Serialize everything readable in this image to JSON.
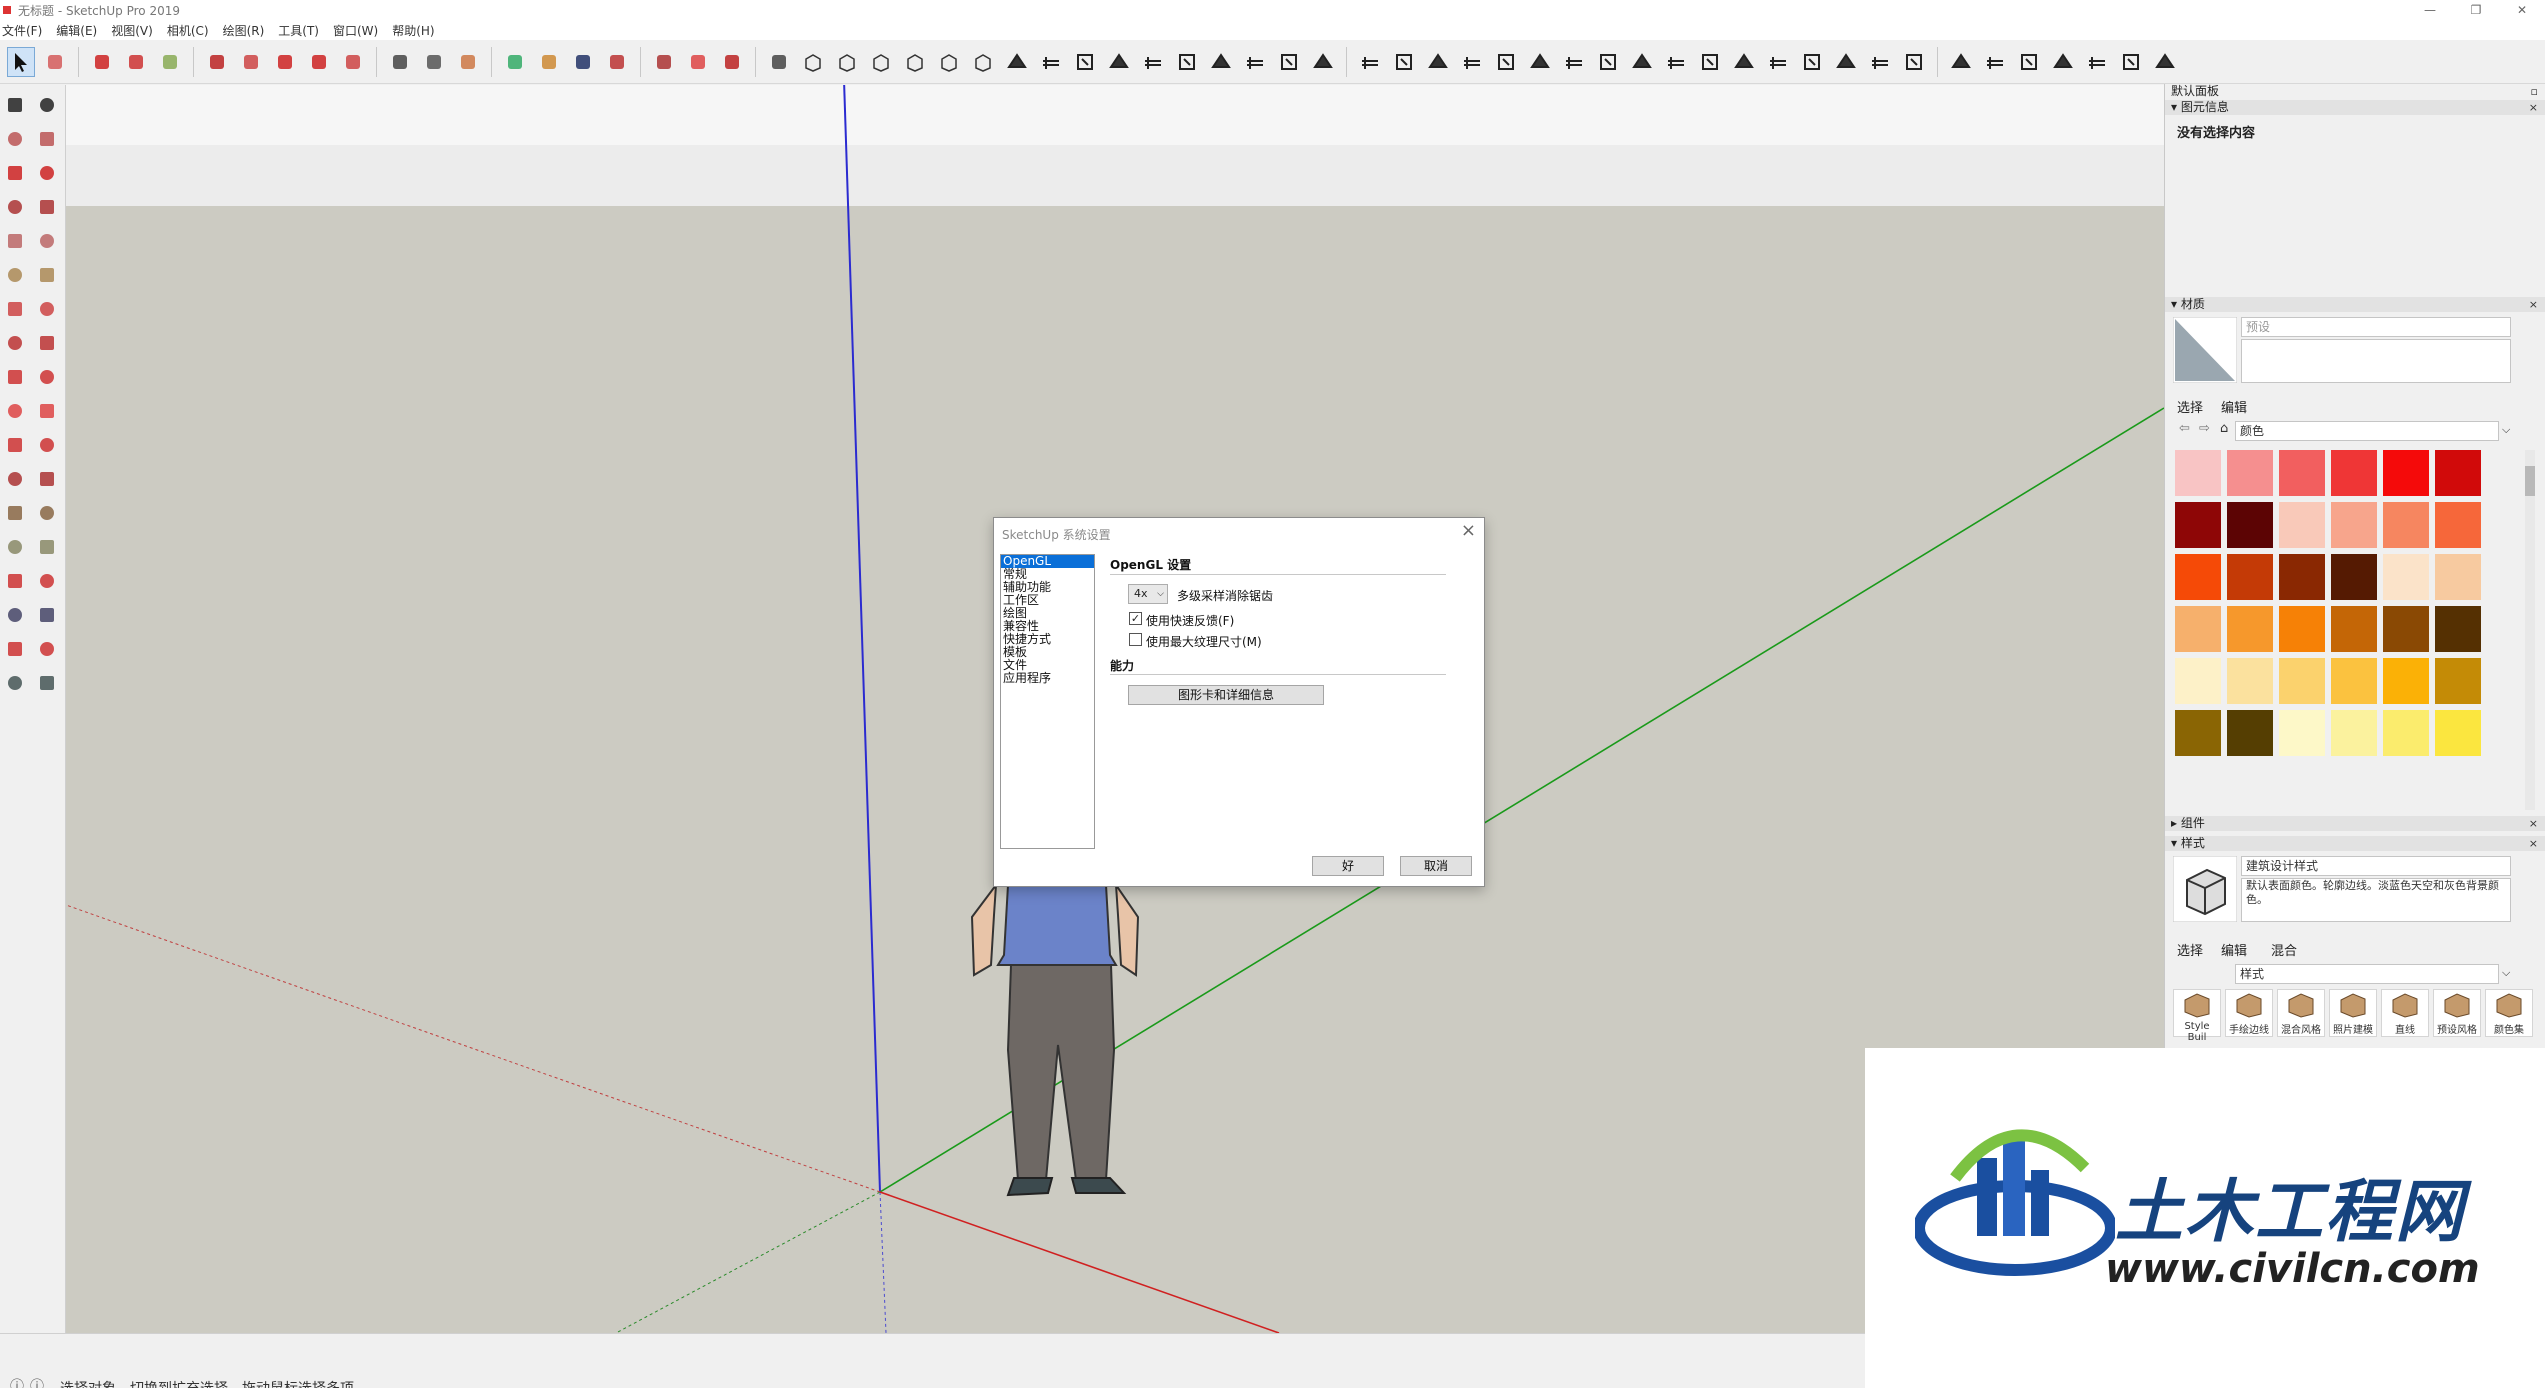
{
  "window": {
    "title": "无标题 - SketchUp Pro 2019",
    "controls": [
      "—",
      "❐",
      "✕"
    ]
  },
  "menus": [
    "文件(F)",
    "编辑(E)",
    "视图(V)",
    "相机(C)",
    "绘图(R)",
    "工具(T)",
    "窗口(W)",
    "帮助(H)"
  ],
  "toolbar": {
    "tools": [
      "select-icon",
      "eraser-icon",
      "line-icon",
      "arc-icon",
      "rectangle-icon",
      "pushpull-icon",
      "followme-icon",
      "move-icon",
      "rotate-icon",
      "scale-icon",
      "tape-icon",
      "text-icon",
      "paint-icon",
      "orbit-icon",
      "pan-icon",
      "zoom-icon",
      "zoomextents-icon",
      "warehouse-icon",
      "extension-icon",
      "ruby-icon",
      "user-icon"
    ],
    "views": [
      "iso-view-icon",
      "top-view-icon",
      "front-view-icon",
      "right-view-icon",
      "back-view-icon",
      "left-view-icon"
    ]
  },
  "status": {
    "text": "选择对象。切换到扩充选择。拖动鼠标选择多项。"
  },
  "tray": {
    "title": "默认面板",
    "entity_info": {
      "header": "图元信息",
      "text": "没有选择内容"
    },
    "materials": {
      "header": "材质",
      "name_placeholder": "预设",
      "tabs": [
        "选择",
        "编辑"
      ],
      "library": "颜色",
      "swatches": [
        "#f8c4c4",
        "#f58f8f",
        "#f25f5f",
        "#ef3636",
        "#f50a0a",
        "#d10a0a",
        "#8e0606",
        "#5c0404",
        "#f9c9b9",
        "#f7a58c",
        "#f68660",
        "#f6673a",
        "#f54a07",
        "#c43a06",
        "#8a2802",
        "#551a02",
        "#fbe3c9",
        "#f7caa0",
        "#f6b06c",
        "#f6982c",
        "#f68106",
        "#c46606",
        "#8a4904",
        "#553002",
        "#fdf1c8",
        "#fbe19e",
        "#fbd26d",
        "#fbc23f",
        "#fbb106",
        "#c48b06",
        "#8a6504",
        "#553e02"
      ],
      "swatches_cut": [
        "#fdf8c8",
        "#fbf29e",
        "#fbec6d",
        "#fbe63f"
      ]
    },
    "components": {
      "header": "组件"
    },
    "styles": {
      "header": "样式",
      "name": "建筑设计样式",
      "description": "默认表面颜色。轮廓边线。淡蓝色天空和灰色背景颜色。",
      "tabs": [
        "选择",
        "编辑",
        "混合"
      ],
      "library": "样式",
      "items": [
        "Style Buil",
        "手绘边线",
        "混合风格",
        "照片建模",
        "直线",
        "预设风格",
        "颜色集"
      ]
    }
  },
  "dialog": {
    "title": "SketchUp 系统设置",
    "nav": [
      "OpenGL",
      "常规",
      "辅助功能",
      "工作区",
      "绘图",
      "兼容性",
      "快捷方式",
      "模板",
      "文件",
      "应用程序"
    ],
    "selected_nav": "OpenGL",
    "section": "OpenGL 设置",
    "antialias_value": "4x",
    "antialias_label": "多级采样消除锯齿",
    "fast_feedback": {
      "label": "使用快速反馈(F)",
      "checked": true
    },
    "max_texture": {
      "label": "使用最大纹理尺寸(M)",
      "checked": false
    },
    "capability": "能力",
    "gpu_button": "图形卡和详细信息",
    "ok": "好",
    "cancel": "取消"
  },
  "watermark": {
    "title": "土木工程网",
    "url": "www.civilcn.com"
  }
}
